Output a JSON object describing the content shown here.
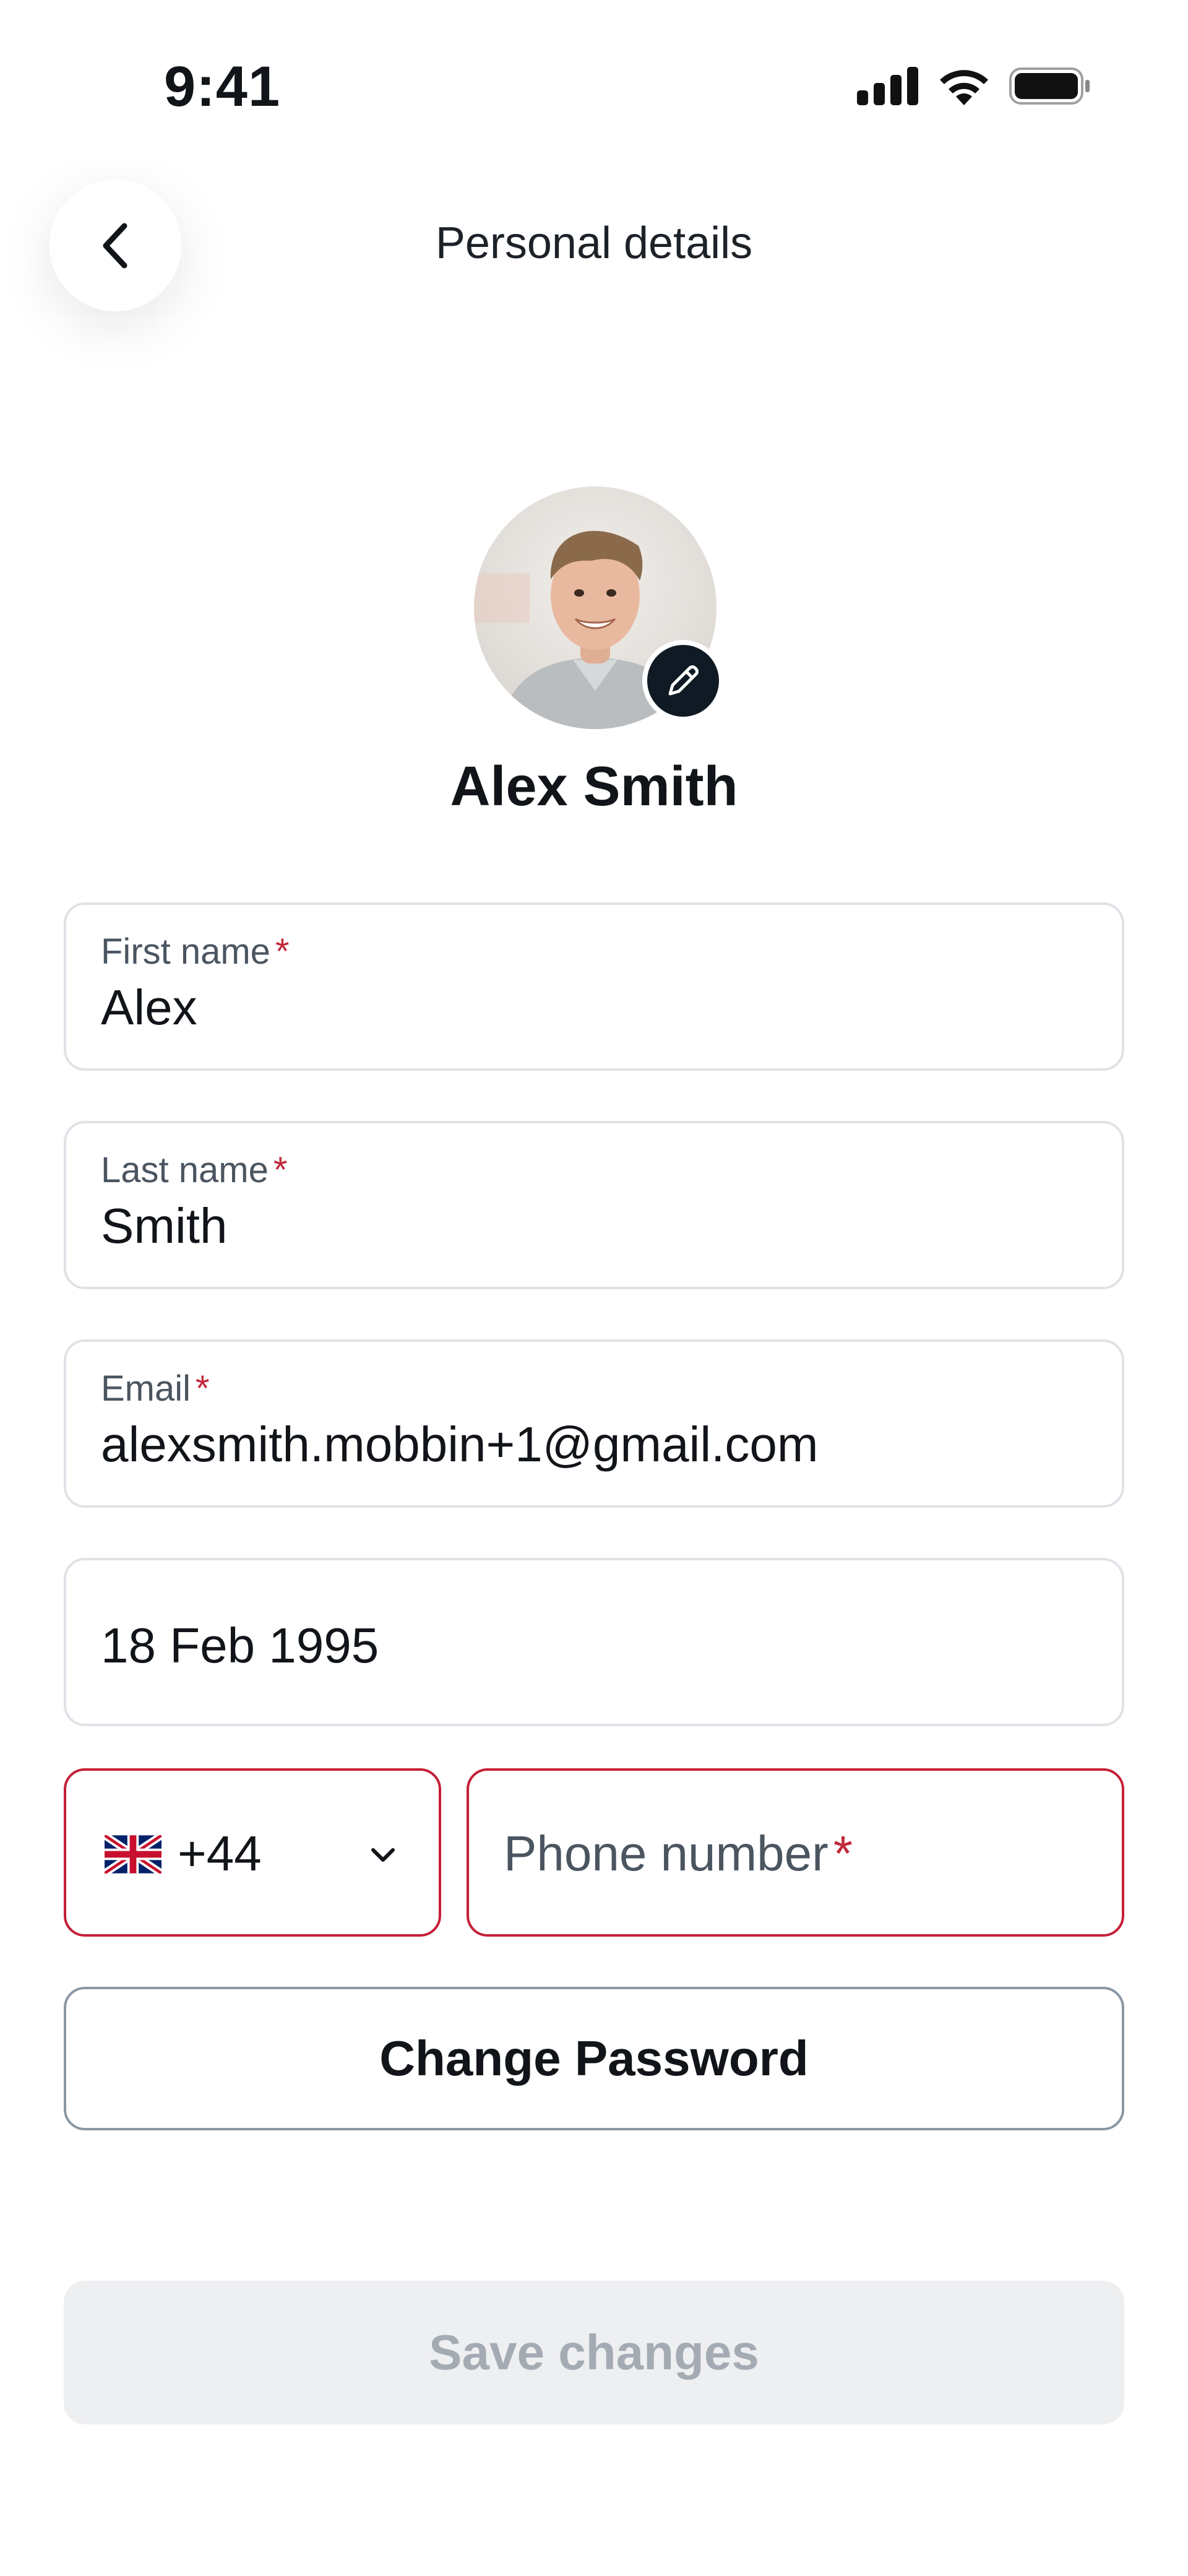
{
  "status_bar": {
    "time": "9:41"
  },
  "header": {
    "title": "Personal details"
  },
  "profile": {
    "name": "Alex Smith"
  },
  "form": {
    "first_name": {
      "label": "First name",
      "required": "*",
      "value": "Alex"
    },
    "last_name": {
      "label": "Last name",
      "required": "*",
      "value": "Smith"
    },
    "email": {
      "label": "Email",
      "required": "*",
      "value": "alexsmith.mobbin+1@gmail.com"
    },
    "birth_date": {
      "value": "18 Feb 1995"
    },
    "country_code": {
      "value": "+44",
      "flag": "uk-flag-icon"
    },
    "phone": {
      "placeholder": "Phone number",
      "required": "*"
    }
  },
  "buttons": {
    "change_password": "Change Password",
    "save_changes": "Save changes"
  },
  "colors": {
    "error": "#c51f37",
    "dark": "#0f1a24",
    "disabled_bg": "#eeeff1",
    "disabled_text": "#a4abb3"
  }
}
